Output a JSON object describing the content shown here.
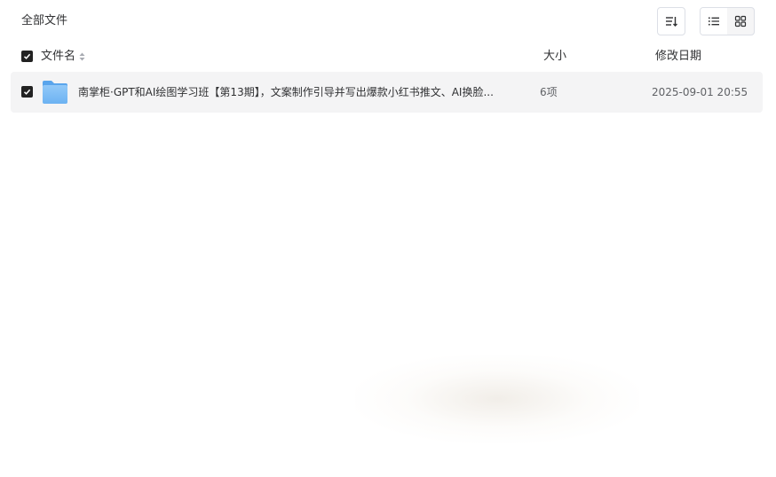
{
  "breadcrumb": {
    "label": "全部文件"
  },
  "toolbar": {
    "sort_icon": "sort-icon",
    "list_view_icon": "list-view-icon",
    "grid_view_icon": "grid-view-icon",
    "active_view": "list"
  },
  "table": {
    "columns": {
      "name": "文件名",
      "size": "大小",
      "modified": "修改日期"
    },
    "select_all_checked": true,
    "rows": [
      {
        "checked": true,
        "icon": "folder-icon",
        "name": "南掌柜·GPT和AI绘图学习班【第13期】，文案制作引导并写出爆款小红书推文、AI换脸...",
        "size": "6项",
        "modified": "2025-09-01 20:55"
      }
    ]
  },
  "colors": {
    "row_bg": "#f4f4f5",
    "folder": "#7fbdf5",
    "checkbox": "#222222"
  }
}
